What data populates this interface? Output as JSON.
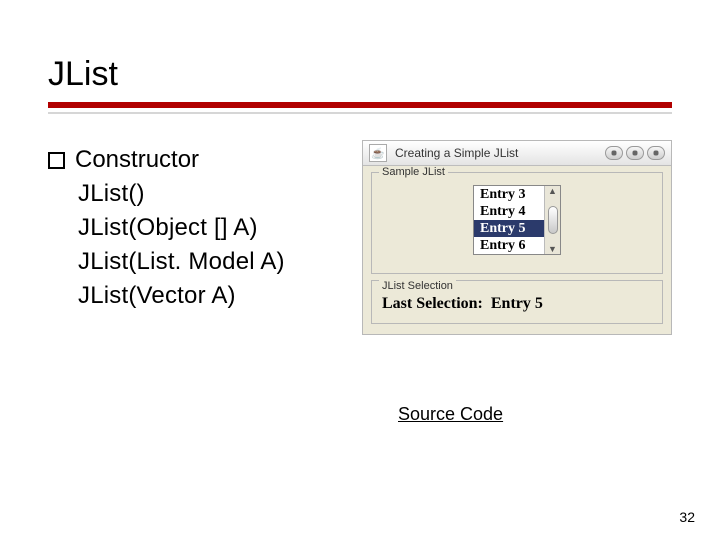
{
  "title": "JList",
  "bullet": "Constructor",
  "constructors": [
    "JList()",
    "JList(Object [] A)",
    "JList(List. Model A)",
    "JList(Vector A)"
  ],
  "window": {
    "title": "Creating a Simple JList",
    "sample_legend": "Sample JList",
    "entries": [
      "Entry 3",
      "Entry 4",
      "Entry 5",
      "Entry 6"
    ],
    "selected_index": 2,
    "selection_legend": "JList Selection",
    "last_selection_label": "Last Selection:",
    "last_selection_value": "Entry 5"
  },
  "link": "Source Code",
  "page": "32"
}
